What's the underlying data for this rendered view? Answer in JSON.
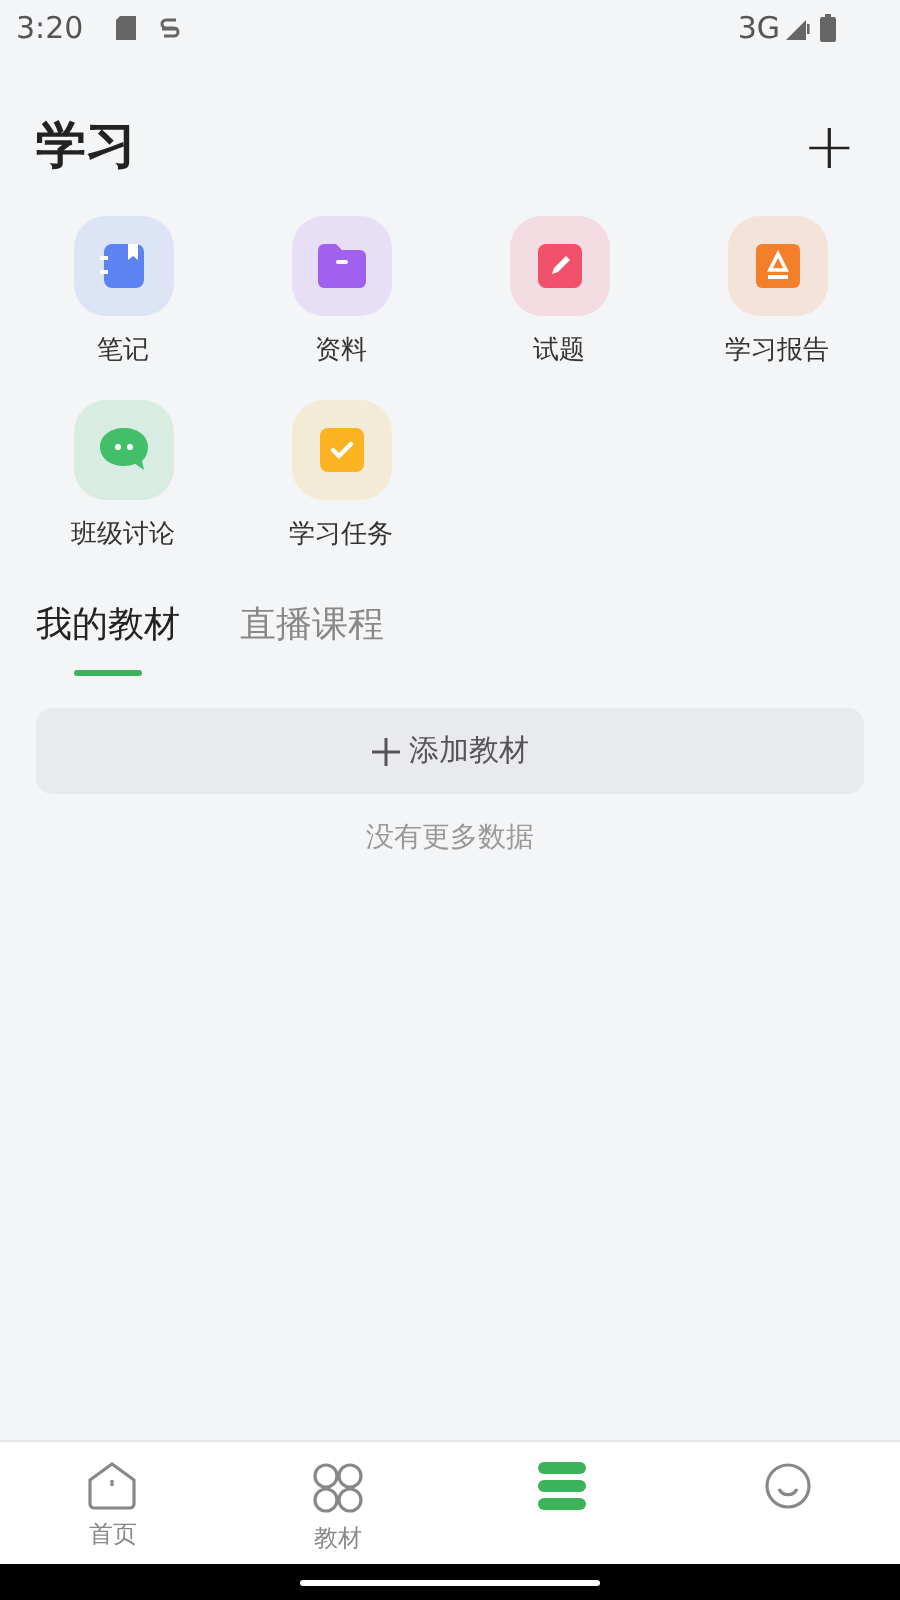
{
  "status_bar": {
    "time": "3:20",
    "network": "3G"
  },
  "header": {
    "title": "学习",
    "add_button": "+"
  },
  "shortcuts": [
    {
      "label": "笔记",
      "kind": "notebook",
      "color": "#5b84f0"
    },
    {
      "label": "资料",
      "kind": "folder",
      "color": "#a062ee"
    },
    {
      "label": "试题",
      "kind": "pencil",
      "color": "#f0506a"
    },
    {
      "label": "学习报告",
      "kind": "report",
      "color": "#f47f2a"
    },
    {
      "label": "班级讨论",
      "kind": "chat",
      "color": "#43bf6a"
    },
    {
      "label": "学习任务",
      "kind": "task",
      "color": "#fbb322"
    }
  ],
  "tabs": [
    {
      "label": "我的教材",
      "selected": true
    },
    {
      "label": "直播课程",
      "selected": false
    }
  ],
  "add_textbook_button": "添加教材",
  "empty_note": "没有更多数据",
  "bottom_nav": [
    {
      "label": "首页",
      "kind": "home",
      "selected": false
    },
    {
      "label": "教材",
      "kind": "grid",
      "selected": false
    },
    {
      "kind": "books",
      "selected": true
    },
    {
      "kind": "smile",
      "selected": false
    }
  ]
}
